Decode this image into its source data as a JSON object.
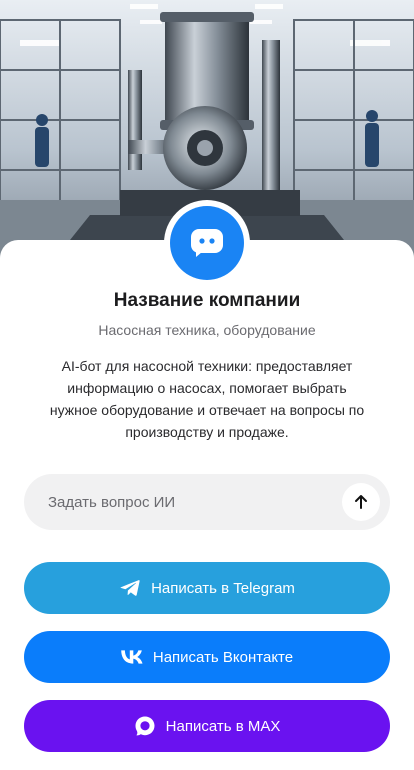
{
  "company": {
    "name": "Название компании",
    "category": "Насосная техника, оборудование",
    "description": "AI-бот для насосной техники: предоставляет информацию о насосах, помогает выбрать нужное оборудование и отвечает на вопросы по производству и продаже."
  },
  "ask": {
    "placeholder": "Задать вопрос ИИ"
  },
  "buttons": {
    "telegram": "Написать в Telegram",
    "vk": "Написать Вконтакте",
    "max": "Написать в MAX"
  },
  "colors": {
    "avatar": "#1a84f4",
    "telegram": "#27a0dd",
    "vk": "#0a7dfb",
    "max": "#6a12f0"
  },
  "icons": {
    "avatar": "chat-bot-icon",
    "send": "arrow-up-icon",
    "telegram": "telegram-icon",
    "vk": "vk-icon",
    "max": "max-icon"
  }
}
